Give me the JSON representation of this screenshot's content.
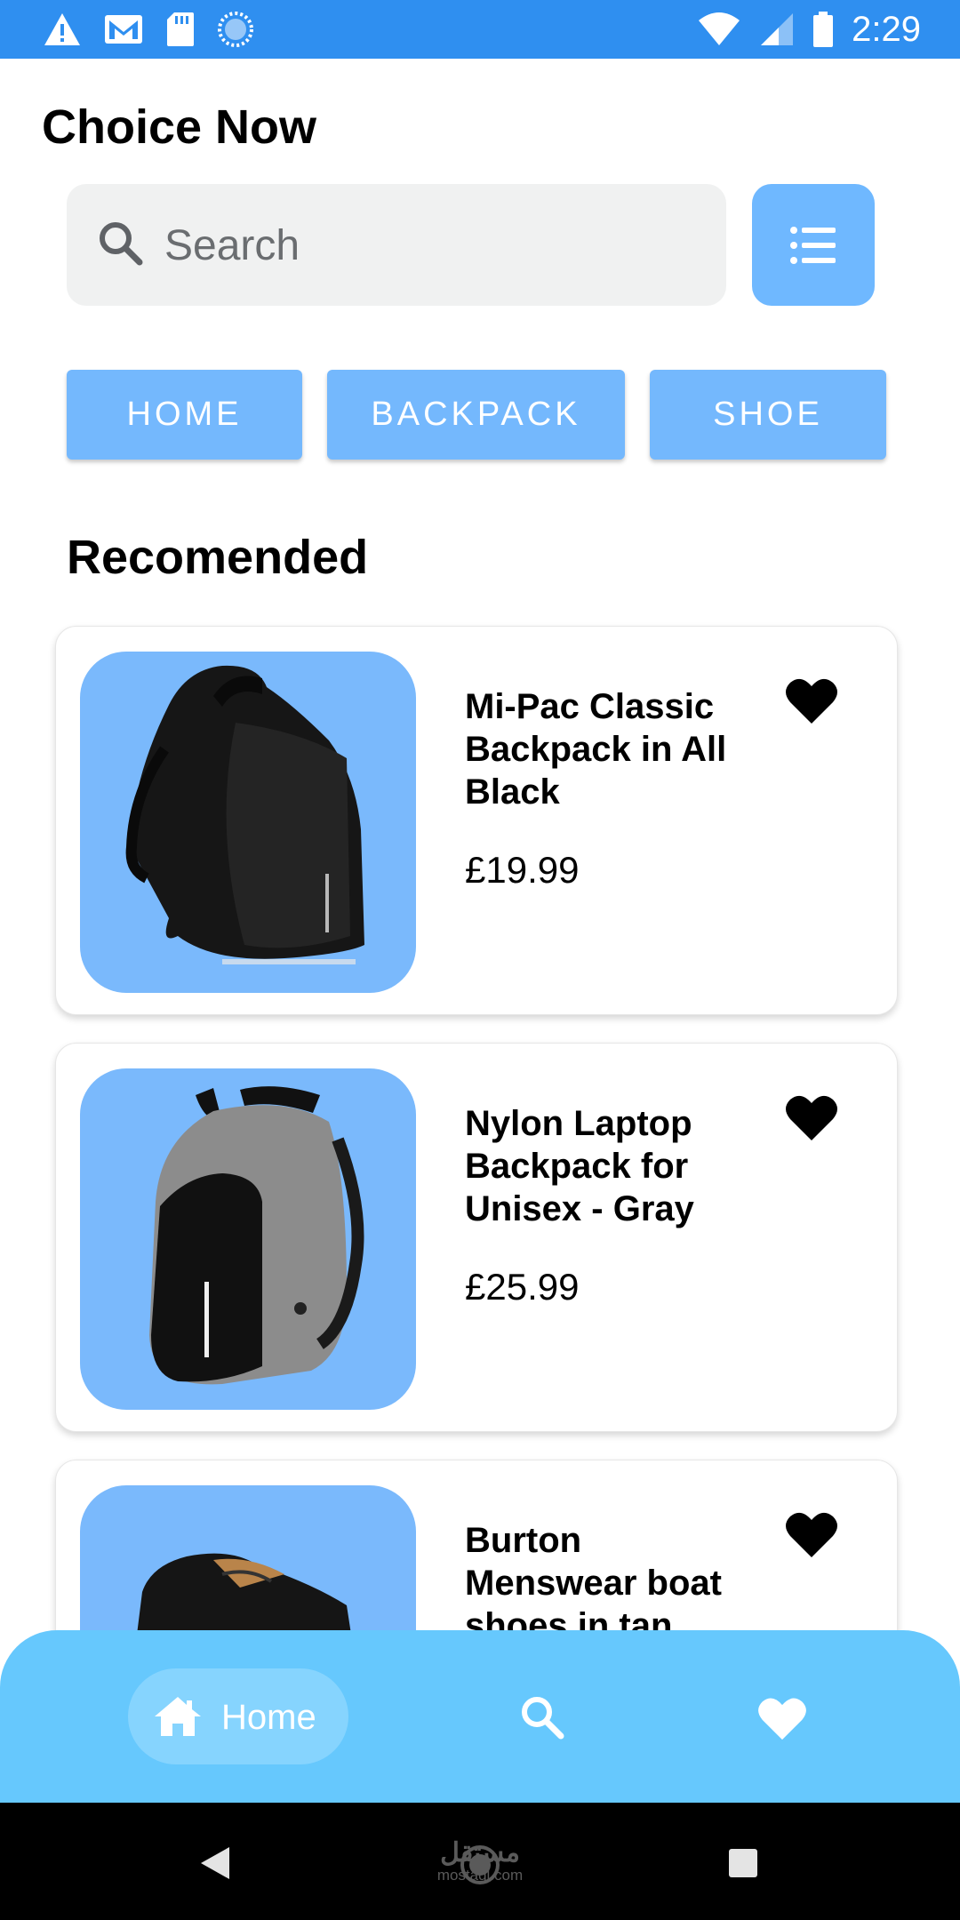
{
  "status_bar": {
    "time": "2:29",
    "icons_left": [
      "warning-icon",
      "gmail-icon",
      "sd-card-icon",
      "loading-icon"
    ],
    "icons_right": [
      "wifi-icon",
      "signal-icon",
      "battery-icon"
    ]
  },
  "app_title": "Choice Now",
  "search": {
    "placeholder": "Search",
    "value": ""
  },
  "categories": [
    "HOME",
    "BACKPACK",
    "SHOE"
  ],
  "section_title": "Recomended",
  "products": [
    {
      "name": "Mi-Pac Classic Backpack in All Black",
      "price": "£19.99"
    },
    {
      "name": "Nylon Laptop Backpack for Unisex - Gray",
      "price": "£25.99"
    },
    {
      "name": "Burton Menswear boat shoes in tan",
      "price": ""
    }
  ],
  "bottom_nav": {
    "home_label": "Home"
  },
  "watermark": {
    "arabic": "مستقل",
    "latin": "mostaql.com"
  },
  "colors": {
    "status_bar": "#2f8ff0",
    "accent": "#74b8fd",
    "image_bg": "#7ab9fc",
    "bottom_nav": "#66c8fd",
    "search_bg": "#f0f1f1"
  }
}
